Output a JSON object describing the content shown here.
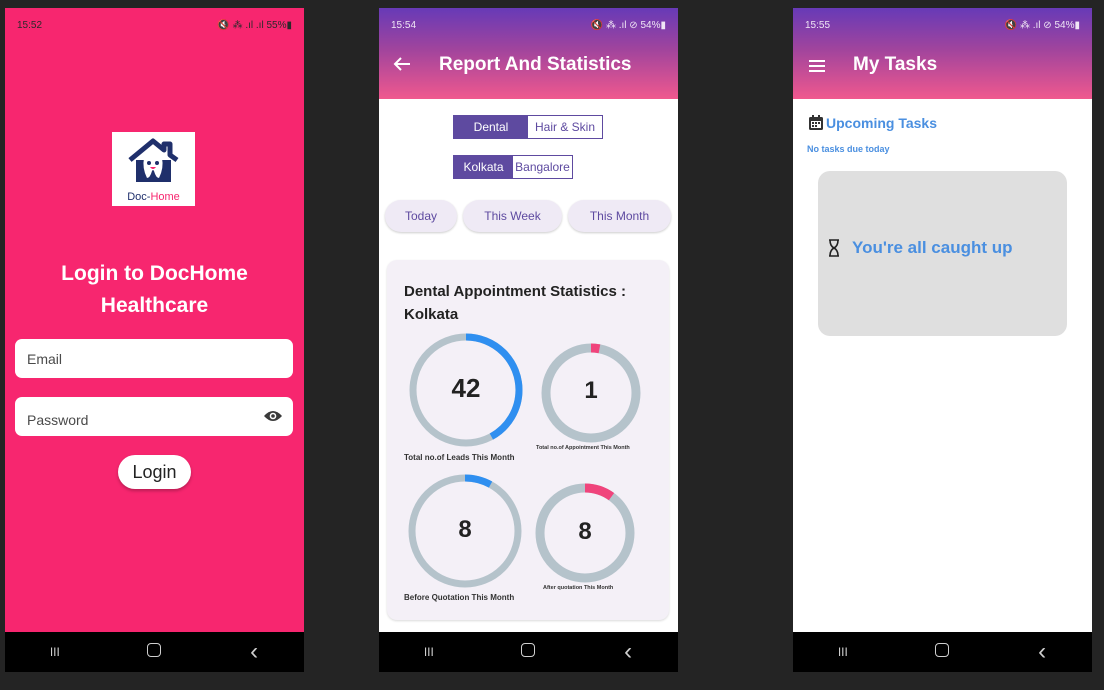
{
  "login_screen": {
    "status": {
      "time": "15:52",
      "icons": "🔇 ⁂ .ıl .ıl",
      "battery": "55%"
    },
    "logo_text_a": "Doc-",
    "logo_text_b": "Home",
    "title": "Login to DocHome Healthcare",
    "email_placeholder": "Email",
    "password_placeholder": "Password",
    "login_label": "Login"
  },
  "report_screen": {
    "status": {
      "time": "15:54",
      "icons": "🔇 ⁂ .ıl ⊘",
      "battery": "54%"
    },
    "title": "Report And Statistics",
    "category_tabs": [
      "Dental",
      "Hair & Skin"
    ],
    "city_tabs": [
      "Kolkata",
      "Bangalore"
    ],
    "period_chips": [
      "Today",
      "This Week",
      "This Month"
    ],
    "card_title": "Dental Appointment Statistics : Kolkata",
    "stats": [
      {
        "value": "42",
        "caption": "Total no.of Leads This Month",
        "progress": 0.42,
        "color": "#2f8ff0"
      },
      {
        "value": "1",
        "caption": "Total no.of Appointment This Month",
        "progress": 0.03,
        "color": "#f0447c"
      },
      {
        "value": "8",
        "caption": "Before Quotation This Month",
        "progress": 0.08,
        "color": "#2f8ff0"
      },
      {
        "value": "8",
        "caption": "After quotation This Month",
        "progress": 0.1,
        "color": "#f0447c"
      }
    ]
  },
  "tasks_screen": {
    "status": {
      "time": "15:55",
      "icons": "🔇 ⁂ .ıl ⊘",
      "battery": "54%"
    },
    "title": "My Tasks",
    "upcoming_title": "Upcoming Tasks",
    "no_tasks_text": "No tasks due today",
    "caught_up_text": "You're all caught up"
  },
  "nav_bar": {
    "recents_glyph": "III",
    "back_glyph": "‹"
  },
  "colors": {
    "pink": "#f7266f",
    "purple": "#5e4aa0",
    "blue_accent": "#4a8fe0",
    "track": "#b5c3cb"
  }
}
